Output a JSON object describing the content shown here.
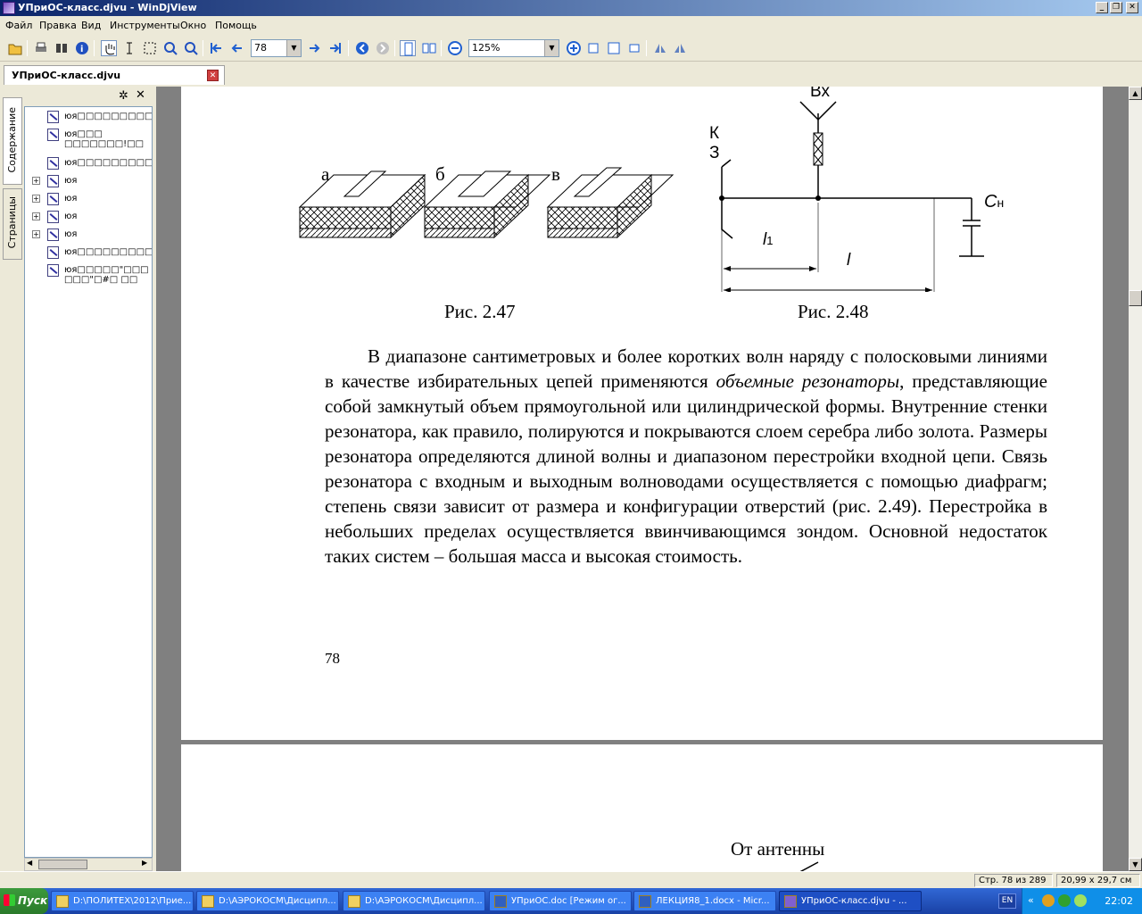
{
  "window": {
    "title": "УПриОС-класс.djvu - WinDjView"
  },
  "menu": [
    "Файл",
    "Правка",
    "Вид",
    "Инструменты",
    "Окно",
    "Помощь"
  ],
  "toolbar": {
    "page_value": "78",
    "zoom_value": "125%"
  },
  "doc_tab": {
    "label": "УПриОС-класс.djvu"
  },
  "sidebar": {
    "tab_contents": "Содержание",
    "tab_pages": "Страницы",
    "tree": [
      {
        "text": "юя□□□□□□□□□",
        "expandable": false
      },
      {
        "text": "юя□□□\n□□□□□□□!□□",
        "expandable": false
      },
      {
        "text": "юя□□□□□□□□□",
        "expandable": false
      },
      {
        "text": "юя",
        "expandable": true
      },
      {
        "text": "юя",
        "expandable": true
      },
      {
        "text": "юя",
        "expandable": true
      },
      {
        "text": "юя",
        "expandable": true
      },
      {
        "text": "юя□□□□□□□□□",
        "expandable": false
      },
      {
        "text": "юя□□□□□\"□□□\n□□□\"□#□ □□",
        "expandable": false
      }
    ]
  },
  "page": {
    "fig47": {
      "caption": "Рис. 2.47",
      "labels": [
        "а",
        "б",
        "в"
      ]
    },
    "fig48": {
      "caption": "Рис. 2.48",
      "label_in": "Вх",
      "label_k": "К",
      "label_z": "З",
      "label_cn": "C",
      "label_cn_sub": "н",
      "label_l1": "l",
      "label_l1_sub": "1",
      "label_l": "l"
    },
    "paragraph_parts": [
      "В диапазоне сантиметровых и более коротких волн наряду с полосковыми линиями в качестве избирательных цепей применяются ",
      "объемные резонаторы",
      ", представляющие собой замкнутый объем прямоугольной или цилиндрической формы. Внутренние стенки резонатора, как правило, полируются и покрываются слоем серебра либо золота. Размеры резонатора определяются длиной волны и диапазоном перестройки входной цепи. Связь резонатора с входным и выходным волноводами осуществляется с помощью диафрагм; степень связи зависит от размера и конфигурации отверстий (рис. 2.49). Перестройка в небольших пределах осуществляется ввинчивающимся зондом. Основной недостаток таких систем – большая масса и высокая стоимость."
    ],
    "page_number": "78",
    "next_page_text": "От антенны"
  },
  "status": {
    "page_info": "Стр. 78 из 289",
    "page_size": "20,99 x 29,7 см"
  },
  "taskbar": {
    "start": "Пуск",
    "tasks": [
      "D:\\ПОЛИТЕХ\\2012\\Прие...",
      "D:\\АЭРОКОСМ\\Дисципл...",
      "D:\\АЭРОКОСМ\\Дисципл...",
      "УПриОС.doc [Режим ог...",
      "ЛЕКЦИЯ8_1.docx - Micr...",
      "УПриОС-класс.djvu - ..."
    ],
    "lang": "EN",
    "clock": "22:02"
  }
}
